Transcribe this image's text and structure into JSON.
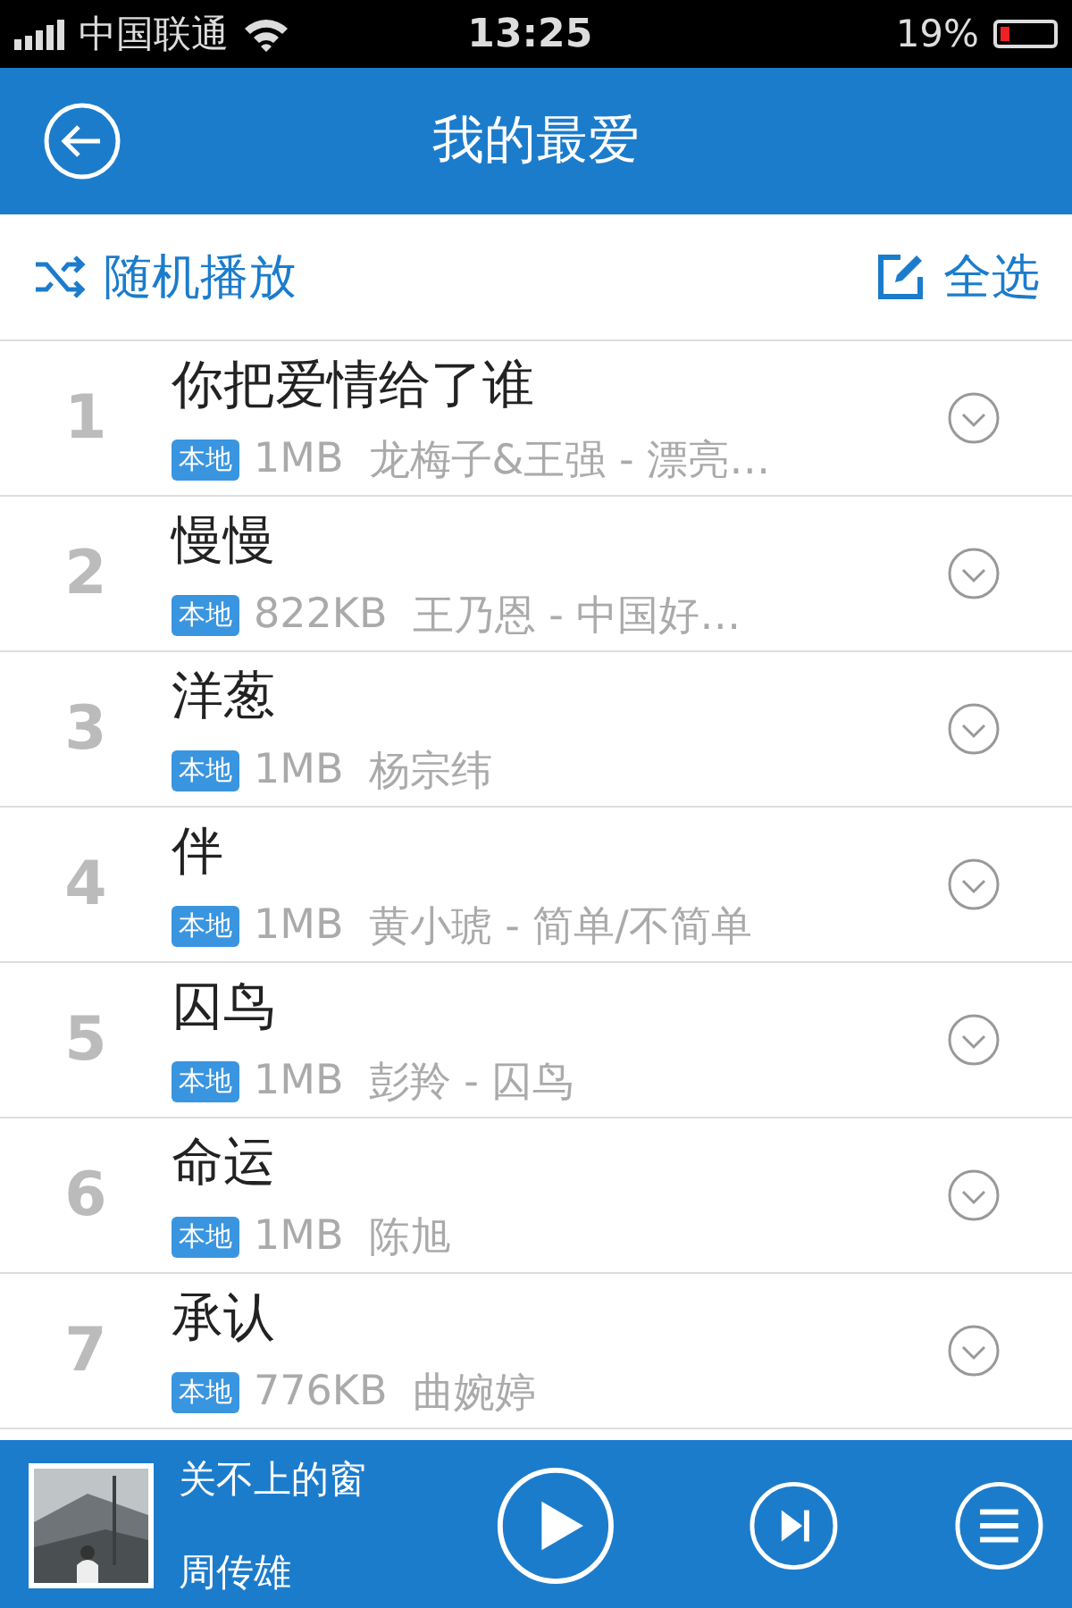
{
  "status_bar": {
    "carrier": "中国联通",
    "time": "13:25",
    "battery": "19%"
  },
  "header": {
    "title": "我的最爱"
  },
  "actions": {
    "shuffle": "随机播放",
    "select_all": "全选"
  },
  "songs": [
    {
      "index": "1",
      "title": "你把爱情给了谁",
      "tag": "本地",
      "size": "1MB",
      "artist": "龙梅子&王强 - 漂亮…"
    },
    {
      "index": "2",
      "title": "慢慢",
      "tag": "本地",
      "size": "822KB",
      "artist": "王乃恩 - 中国好…"
    },
    {
      "index": "3",
      "title": "洋葱",
      "tag": "本地",
      "size": "1MB",
      "artist": "杨宗纬"
    },
    {
      "index": "4",
      "title": "伴",
      "tag": "本地",
      "size": "1MB",
      "artist": "黄小琥 - 简单/不简单"
    },
    {
      "index": "5",
      "title": "囚鸟",
      "tag": "本地",
      "size": "1MB",
      "artist": "彭羚 - 囚鸟"
    },
    {
      "index": "6",
      "title": "命运",
      "tag": "本地",
      "size": "1MB",
      "artist": "陈旭"
    },
    {
      "index": "7",
      "title": "承认",
      "tag": "本地",
      "size": "776KB",
      "artist": "曲婉婷"
    }
  ],
  "player": {
    "title": "关不上的窗",
    "artist": "周传雄"
  }
}
